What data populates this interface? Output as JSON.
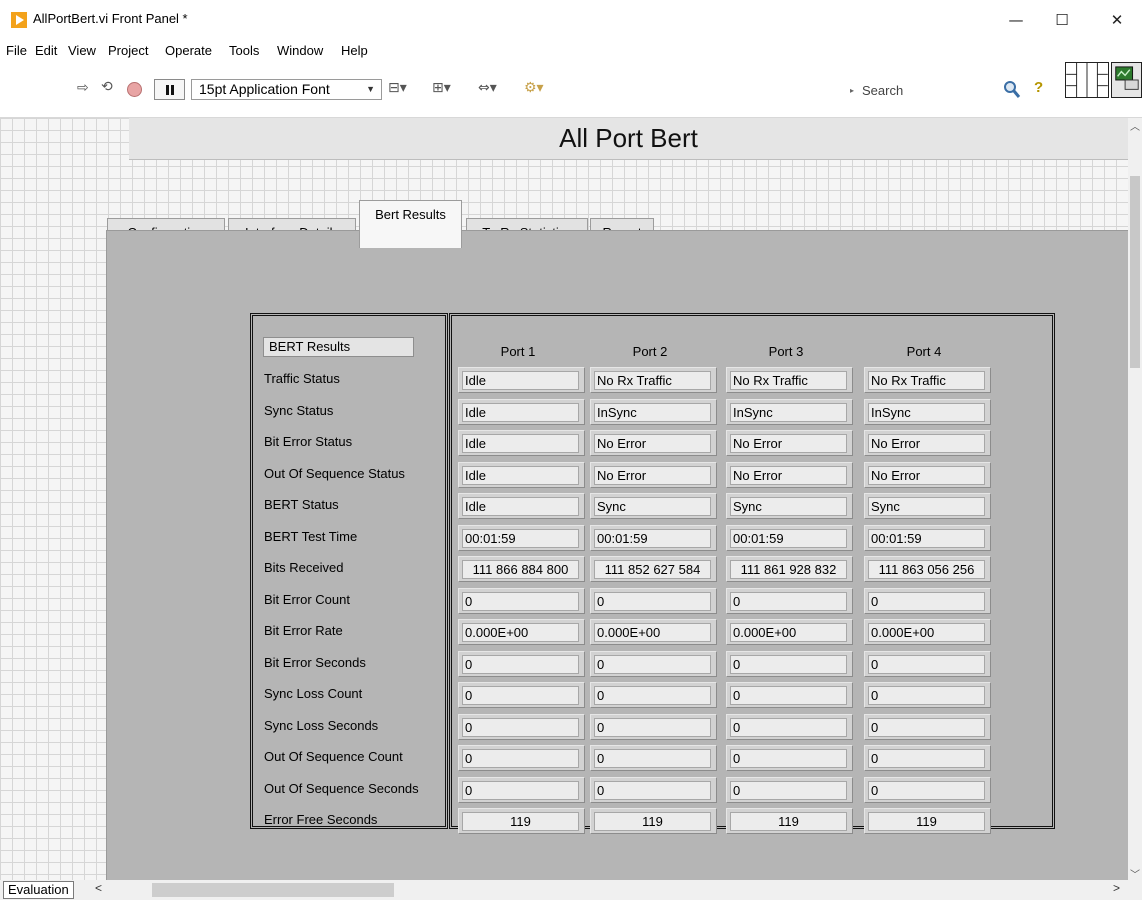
{
  "window": {
    "title": "AllPortBert.vi Front Panel *",
    "minimize_glyph": "—",
    "maximize_glyph": "☐",
    "close_glyph": "✕"
  },
  "menu": [
    "File",
    "Edit",
    "View",
    "Project",
    "Operate",
    "Tools",
    "Window",
    "Help"
  ],
  "toolbar": {
    "font_select": "15pt Application Font",
    "search_placeholder": "Search",
    "icons": [
      "run-icon",
      "run-continuously-icon",
      "abort-icon",
      "pause-icon",
      "align-objects-icon",
      "distribute-objects-icon",
      "resize-objects-icon",
      "reorder-icon",
      "search-icon",
      "help-icon",
      "connector-pane-icon",
      "vi-icon"
    ]
  },
  "panel": {
    "title": "All Port Bert",
    "tabs": [
      "Configuration",
      "Interface Details",
      "Bert Results",
      "Tx Rx Statistics",
      "Report"
    ],
    "active_tab": "Bert Results"
  },
  "results": {
    "heading": "BERT Results",
    "row_labels": [
      "Traffic Status",
      "Sync Status",
      "Bit Error Status",
      "Out Of Sequence Status",
      "BERT Status",
      "BERT Test Time",
      "Bits Received",
      "Bit Error Count",
      "Bit Error Rate",
      "Bit Error Seconds",
      "Sync Loss Count",
      "Sync Loss Seconds",
      "Out Of Sequence Count",
      "Out Of Sequence Seconds",
      "Error Free Seconds"
    ],
    "ports": [
      {
        "name": "Port 1",
        "values": [
          "Idle",
          "Idle",
          "Idle",
          "Idle",
          "Idle",
          "00:01:59",
          "111 866 884 800",
          "0",
          "0.000E+00",
          "0",
          "0",
          "0",
          "0",
          "0",
          "119"
        ]
      },
      {
        "name": "Port 2",
        "values": [
          "No Rx Traffic",
          "InSync",
          "No Error",
          "No Error",
          "Sync",
          "00:01:59",
          "111 852 627 584",
          "0",
          "0.000E+00",
          "0",
          "0",
          "0",
          "0",
          "0",
          "119"
        ]
      },
      {
        "name": "Port 3",
        "values": [
          "No Rx Traffic",
          "InSync",
          "No Error",
          "No Error",
          "Sync",
          "00:01:59",
          "111 861 928 832",
          "0",
          "0.000E+00",
          "0",
          "0",
          "0",
          "0",
          "0",
          "119"
        ]
      },
      {
        "name": "Port 4",
        "values": [
          "No Rx Traffic",
          "InSync",
          "No Error",
          "No Error",
          "Sync",
          "00:01:59",
          "111 863 056 256",
          "0",
          "0.000E+00",
          "0",
          "0",
          "0",
          "0",
          "0",
          "119"
        ]
      }
    ]
  },
  "status": {
    "evaluation": "Evaluation"
  }
}
